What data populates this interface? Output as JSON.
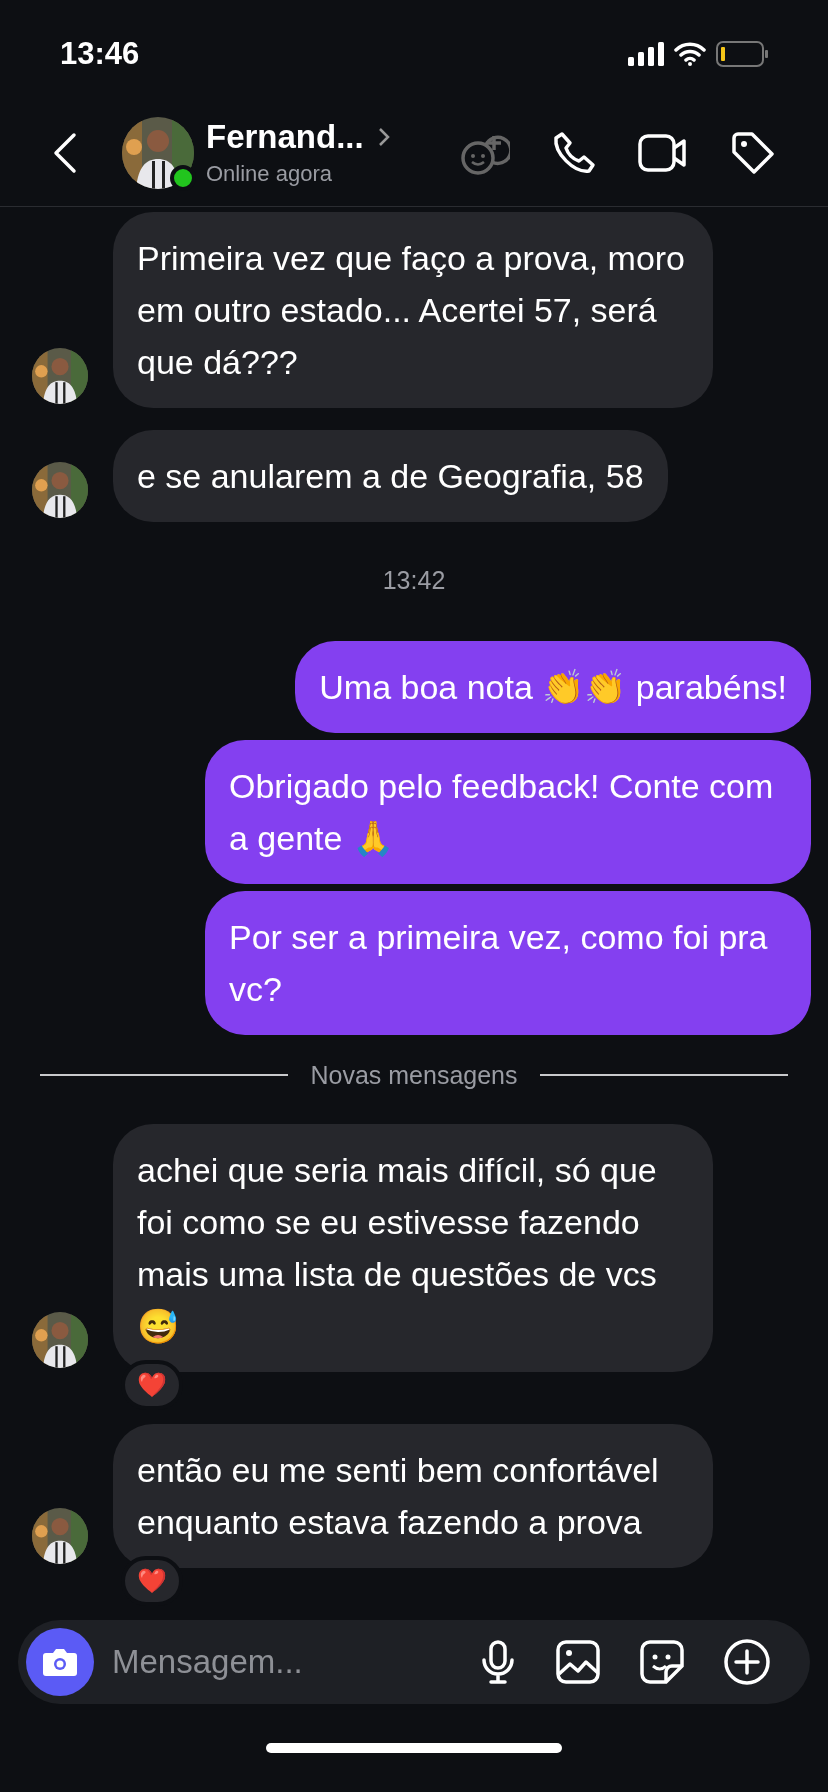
{
  "status_bar": {
    "time": "13:46"
  },
  "header": {
    "name": "Fernand...",
    "status": "Online agora",
    "online": true
  },
  "messages": [
    {
      "kind": "incoming",
      "text": "Primeira vez que faço a prova, moro em outro estado... Acertei 57, será que dá???",
      "avatar": true
    },
    {
      "kind": "incoming",
      "text": "e se anularem a de Geografia, 58",
      "avatar": true
    },
    {
      "kind": "time",
      "text": "13:42"
    },
    {
      "kind": "outgoing",
      "text": "Uma boa nota 👏👏 parabéns!"
    },
    {
      "kind": "outgoing",
      "text": "Obrigado pelo feedback! Conte com a gente 🙏"
    },
    {
      "kind": "outgoing",
      "text": "Por ser a primeira vez, como foi pra vc?"
    },
    {
      "kind": "divider",
      "text": "Novas mensagens"
    },
    {
      "kind": "incoming",
      "text": "achei que seria mais difícil, só que foi como se eu estivesse fazendo mais uma lista de questões de vcs 😅",
      "avatar": true,
      "reaction": "❤️"
    },
    {
      "kind": "incoming",
      "text": "então eu me senti bem confortável enquanto estava fazendo a prova",
      "avatar": true,
      "reaction": "❤️"
    }
  ],
  "composer": {
    "placeholder": "Mensagem..."
  }
}
